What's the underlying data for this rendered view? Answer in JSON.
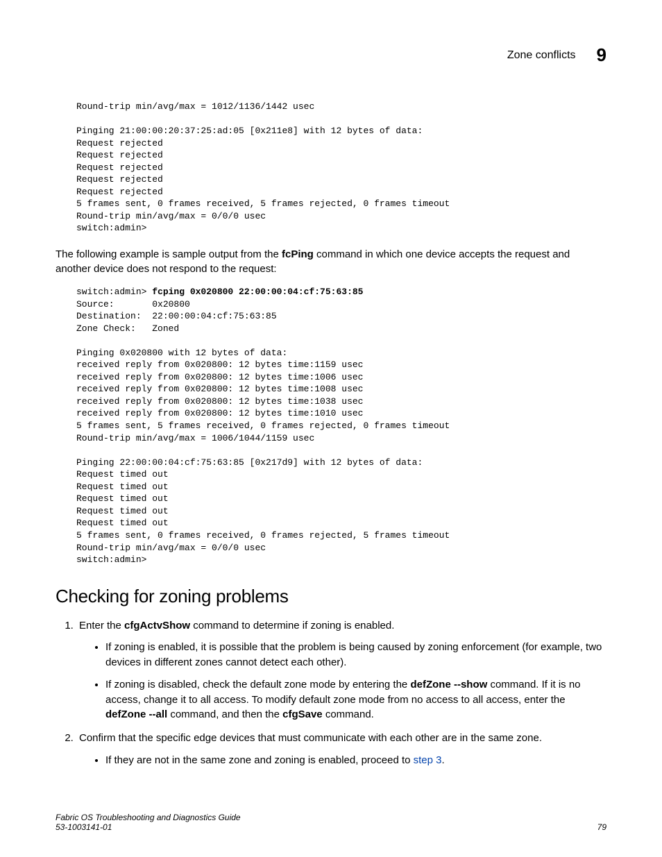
{
  "header": {
    "title": "Zone conflicts",
    "chapter": "9"
  },
  "code_block_1": "Round-trip min/avg/max = 1012/1136/1442 usec\n\nPinging 21:00:00:20:37:25:ad:05 [0x211e8] with 12 bytes of data:\nRequest rejected\nRequest rejected\nRequest rejected\nRequest rejected\nRequest rejected\n5 frames sent, 0 frames received, 5 frames rejected, 0 frames timeout\nRound-trip min/avg/max = 0/0/0 usec\nswitch:admin>",
  "para1_pre": "The following example is sample output from the ",
  "para1_cmd": "fcPing",
  "para1_post": " command in which one device accepts the request and another device does not respond to the request:",
  "code2_prompt": "switch:admin> ",
  "code2_cmd": "fcping 0x020800 22:00:00:04:cf:75:63:85",
  "code2_body": "Source:       0x20800\nDestination:  22:00:00:04:cf:75:63:85\nZone Check:   Zoned\n\nPinging 0x020800 with 12 bytes of data:\nreceived reply from 0x020800: 12 bytes time:1159 usec\nreceived reply from 0x020800: 12 bytes time:1006 usec\nreceived reply from 0x020800: 12 bytes time:1008 usec\nreceived reply from 0x020800: 12 bytes time:1038 usec\nreceived reply from 0x020800: 12 bytes time:1010 usec\n5 frames sent, 5 frames received, 0 frames rejected, 0 frames timeout\nRound-trip min/avg/max = 1006/1044/1159 usec\n\nPinging 22:00:00:04:cf:75:63:85 [0x217d9] with 12 bytes of data:\nRequest timed out\nRequest timed out\nRequest timed out\nRequest timed out\nRequest timed out\n5 frames sent, 0 frames received, 0 frames rejected, 5 frames timeout\nRound-trip min/avg/max = 0/0/0 usec\nswitch:admin>",
  "section_heading": "Checking for zoning problems",
  "step1_pre": "Enter the ",
  "step1_cmd": "cfgActvShow",
  "step1_post": " command to determine if zoning is enabled.",
  "step1_b1": "If zoning is enabled, it is possible that the problem is being caused by zoning enforcement (for example, two devices in different zones cannot detect each other).",
  "step1_b2_1": "If zoning is disabled, check the default zone mode by entering the ",
  "step1_b2_cmd1": "defZone --show",
  "step1_b2_2": " command. If it is no access, change it to all access. To modify default zone mode from no access to all access, enter the ",
  "step1_b2_cmd2": "defZone --all",
  "step1_b2_3": " command, and then the ",
  "step1_b2_cmd3": "cfgSave",
  "step1_b2_4": " command.",
  "step2": "Confirm that the specific edge devices that must communicate with each other are in the same zone.",
  "step2_b1_1": "If they are not in the same zone and zoning is enabled, proceed to ",
  "step2_b1_link": "step 3",
  "step2_b1_2": ".",
  "footer": {
    "doc_title": "Fabric OS Troubleshooting and Diagnostics Guide",
    "doc_num": "53-1003141-01",
    "page_num": "79"
  }
}
